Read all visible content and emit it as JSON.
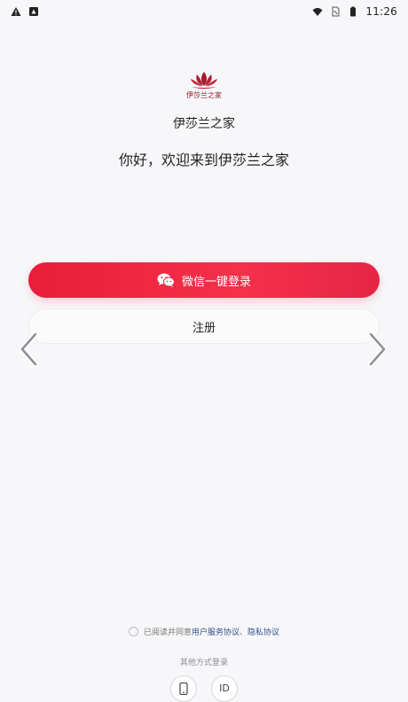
{
  "status_bar": {
    "time": "11:26",
    "left_icons": [
      "warning-icon",
      "notification-icon"
    ],
    "right_icons": [
      "wifi-icon",
      "sim-icon",
      "battery-icon"
    ]
  },
  "brand": {
    "logo_caption": "伊莎兰之家",
    "name": "伊莎兰之家",
    "welcome": "你好，欢迎来到伊莎兰之家",
    "logo_color": "#a41c2e"
  },
  "actions": {
    "wechat_login": "微信一键登录",
    "register": "注册",
    "accent_color": "#e81e3a"
  },
  "agreement": {
    "prefix": "已阅读并同意",
    "user_service": "用户服务协议",
    "separator": "、",
    "privacy": "隐私协议"
  },
  "other_methods": {
    "label": "其他方式登录",
    "options": [
      {
        "icon": "phone-icon"
      },
      {
        "label": "ID",
        "icon": "id-icon"
      }
    ]
  },
  "navigation": {
    "left": "chevron-left-icon",
    "right": "chevron-right-icon"
  }
}
